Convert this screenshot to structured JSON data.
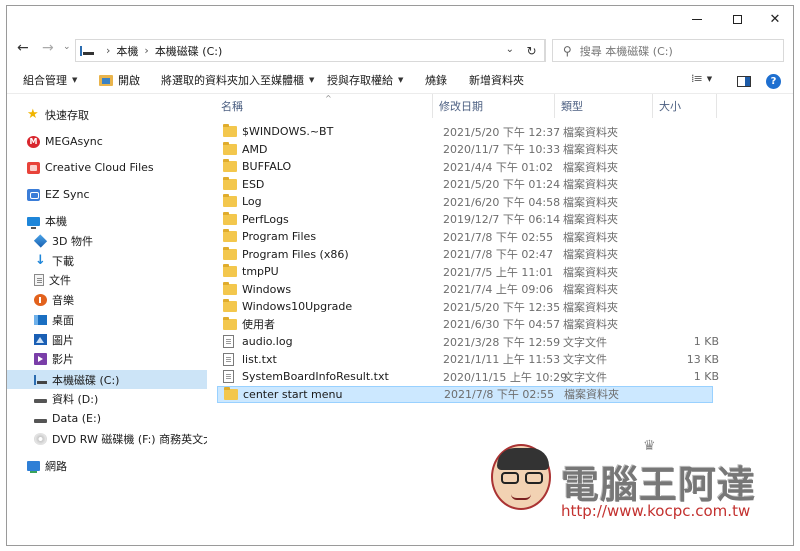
{
  "window": {
    "min_icon": "minimize-icon",
    "max_icon": "maximize-icon",
    "close_label": "✕"
  },
  "address": {
    "back": "←",
    "forward": "→",
    "recent": "⌄",
    "up": "↑",
    "crumbs": [
      "本機",
      "本機磁碟 (C:)"
    ],
    "separator": "›",
    "dropdown": "⌄",
    "refresh": "↻",
    "search_placeholder": "搜尋 本機磁碟 (C:)"
  },
  "toolbar": {
    "organize": "組合管理",
    "open": "開啟",
    "include_library": "將選取的資料夾加入至媒體櫃",
    "share_burn": "授與存取權給",
    "burn": "燒錄",
    "new_folder": "新增資料夾",
    "caret": "▼",
    "view_glyph": "⁞≡",
    "help": "?"
  },
  "nav": [
    {
      "label": "快速存取",
      "icon": "star-icon"
    },
    {
      "label": "MEGAsync",
      "icon": "megasync-icon"
    },
    {
      "label": "Creative Cloud Files",
      "icon": "creative-cloud-icon"
    },
    {
      "label": "EZ Sync",
      "icon": "ez-sync-icon"
    },
    {
      "label": "本機",
      "icon": "this-pc-icon"
    },
    {
      "label": "3D 物件",
      "icon": "3d-objects-icon"
    },
    {
      "label": "下載",
      "icon": "downloads-icon"
    },
    {
      "label": "文件",
      "icon": "documents-icon"
    },
    {
      "label": "音樂",
      "icon": "music-icon"
    },
    {
      "label": "桌面",
      "icon": "desktop-icon"
    },
    {
      "label": "圖片",
      "icon": "pictures-icon"
    },
    {
      "label": "影片",
      "icon": "videos-icon"
    },
    {
      "label": "本機磁碟 (C:)",
      "icon": "local-disk-icon",
      "selected": true
    },
    {
      "label": "資料 (D:)",
      "icon": "drive-icon"
    },
    {
      "label": "Data (E:)",
      "icon": "drive-icon"
    },
    {
      "label": "DVD RW 磁碟機 (F:) 商務英文大解",
      "icon": "dvd-icon"
    },
    {
      "label": "網路",
      "icon": "network-icon"
    }
  ],
  "columns": {
    "name": "名稱",
    "modified": "修改日期",
    "type": "類型",
    "size": "大小",
    "sort_glyph": "^"
  },
  "files": [
    {
      "name": "$WINDOWS.~BT",
      "date": "2021/5/20 下午 12:37",
      "type": "檔案資料夾",
      "size": "",
      "kind": "folder"
    },
    {
      "name": "AMD",
      "date": "2020/11/7 下午 10:33",
      "type": "檔案資料夾",
      "size": "",
      "kind": "folder"
    },
    {
      "name": "BUFFALO",
      "date": "2021/4/4 下午 01:02",
      "type": "檔案資料夾",
      "size": "",
      "kind": "folder"
    },
    {
      "name": "ESD",
      "date": "2021/5/20 下午 01:24",
      "type": "檔案資料夾",
      "size": "",
      "kind": "folder"
    },
    {
      "name": "Log",
      "date": "2021/6/20 下午 04:58",
      "type": "檔案資料夾",
      "size": "",
      "kind": "folder"
    },
    {
      "name": "PerfLogs",
      "date": "2019/12/7 下午 06:14",
      "type": "檔案資料夾",
      "size": "",
      "kind": "folder"
    },
    {
      "name": "Program Files",
      "date": "2021/7/8 下午 02:55",
      "type": "檔案資料夾",
      "size": "",
      "kind": "folder"
    },
    {
      "name": "Program Files (x86)",
      "date": "2021/7/8 下午 02:47",
      "type": "檔案資料夾",
      "size": "",
      "kind": "folder"
    },
    {
      "name": "tmpPU",
      "date": "2021/7/5 上午 11:01",
      "type": "檔案資料夾",
      "size": "",
      "kind": "folder"
    },
    {
      "name": "Windows",
      "date": "2021/7/4 上午 09:06",
      "type": "檔案資料夾",
      "size": "",
      "kind": "folder"
    },
    {
      "name": "Windows10Upgrade",
      "date": "2021/5/20 下午 12:35",
      "type": "檔案資料夾",
      "size": "",
      "kind": "folder"
    },
    {
      "name": "使用者",
      "date": "2021/6/30 下午 04:57",
      "type": "檔案資料夾",
      "size": "",
      "kind": "folder"
    },
    {
      "name": "audio.log",
      "date": "2021/3/28 下午 12:59",
      "type": "文字文件",
      "size": "1 KB",
      "kind": "file"
    },
    {
      "name": "list.txt",
      "date": "2021/1/11 上午 11:53",
      "type": "文字文件",
      "size": "13 KB",
      "kind": "file"
    },
    {
      "name": "SystemBoardInfoResult.txt",
      "date": "2020/11/15 上午 10:29",
      "type": "文字文件",
      "size": "1 KB",
      "kind": "file"
    },
    {
      "name": "center start menu",
      "date": "2021/7/8 下午 02:55",
      "type": "檔案資料夾",
      "size": "",
      "kind": "folder",
      "selected": true
    }
  ],
  "watermark": {
    "title": "電腦王阿達",
    "url": "http://www.kocpc.com.tw",
    "crown": "♛"
  },
  "colors": {
    "selection": "#cce8ff",
    "nav_selection": "#cce4f7",
    "header_text": "#4d6082",
    "accent": "#1e6fd0",
    "watermark_url": "#c3312f"
  }
}
